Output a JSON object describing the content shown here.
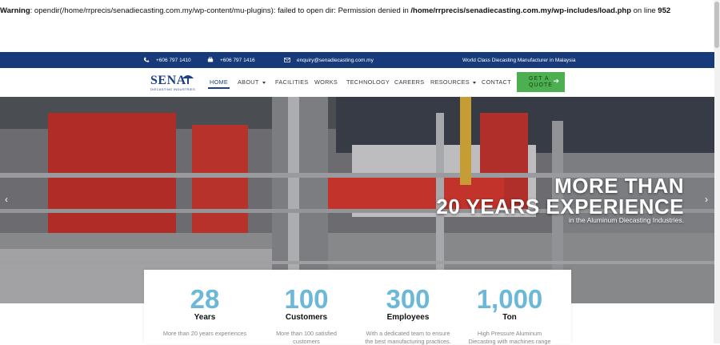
{
  "warning": {
    "label": "Warning",
    "message_a": ": opendir(/home/rrprecis/senadiecasting.com.my/wp-content/mu-plugins): failed to open dir: Permission denied in ",
    "path": "/home/rrprecis/senadiecasting.com.my/wp-includes/load.php",
    "message_b": " on line ",
    "line": "952"
  },
  "topbar": {
    "phone": "+606 797 1410",
    "fax": "+606 797 1416",
    "email": "enquiry@senadiecasting.com.my",
    "tagline": "World Class Diecasting Manufacturer in Malaysia",
    "bg_color": "#173a7a"
  },
  "logo": {
    "name": "SENA",
    "sub": "DIECASTING INDUSTRIES"
  },
  "menu": {
    "home": "HOME",
    "about": "ABOUT",
    "facilities": "FACILITIES",
    "works": "WORKS",
    "technology": "TECHNOLOGY",
    "careers": "CAREERS",
    "resources": "RESOURCES",
    "contact": "CONTACT",
    "quote_line1": "GET A",
    "quote_line2": "QUOTE"
  },
  "hero": {
    "title_line1": "MORE THAN",
    "title_line2": "20 YEARS EXPERIENCE",
    "subtitle": "in the Aluminum  Diecasting Industries."
  },
  "stats": [
    {
      "num": "28",
      "unit": "Years",
      "desc_1": "More than 20 years experiences",
      "desc_2": ""
    },
    {
      "num": "100",
      "unit": "Customers",
      "desc_1": "More than 100 satisfied",
      "desc_2": "customers"
    },
    {
      "num": "300",
      "unit": "Employees",
      "desc_1": "With a dedicated team to ensure",
      "desc_2": "the best manufacturing practices."
    },
    {
      "num": "1,000",
      "unit": "Ton",
      "desc_1": "High Pressure Aluminum",
      "desc_2": "Diecasting with machines range"
    }
  ],
  "colors": {
    "accent": "#6bb8d8",
    "brand": "#1d3f86",
    "quote_button": "#4caf50"
  }
}
